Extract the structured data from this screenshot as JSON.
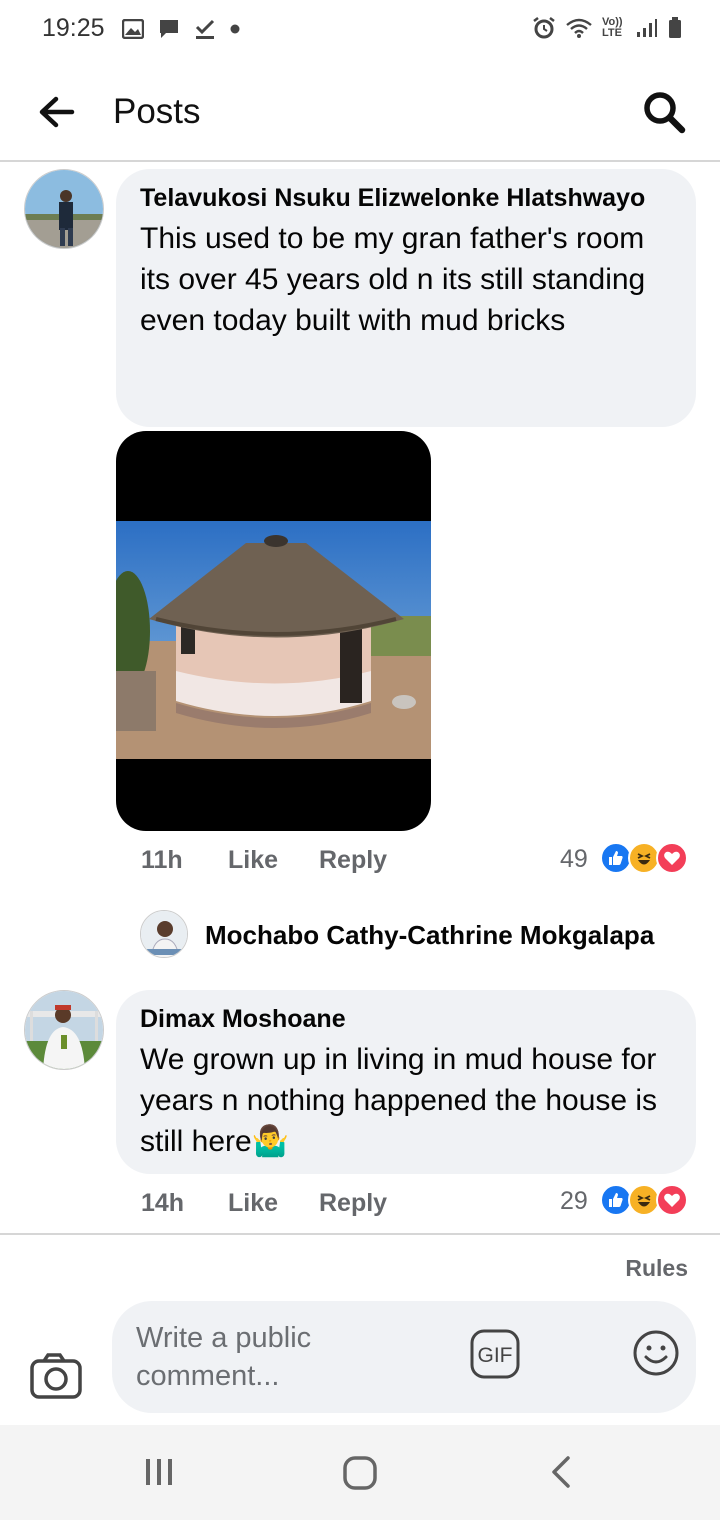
{
  "status_bar": {
    "time": "19:25",
    "left_icons": [
      "image-icon",
      "chat-icon",
      "check-icon",
      "dot-icon"
    ],
    "right_icons": [
      "alarm-icon",
      "wifi-icon",
      "volte-icon",
      "signal-icon",
      "battery-icon"
    ],
    "volte_label": "Vo)) LTE"
  },
  "header": {
    "title": "Posts",
    "back_icon": "back-arrow-icon",
    "search_icon": "search-icon"
  },
  "comments": [
    {
      "author": "Telavukosi Nsuku Elizwelonke Hlatshwayo",
      "text": "This used to be my gran father's room its over 45 years old n its still standing even today built with mud bricks",
      "time": "11h",
      "like_label": "Like",
      "reply_label": "Reply",
      "reaction_count": "49",
      "reactions": [
        "like-icon",
        "haha-icon",
        "love-icon"
      ],
      "reply_preview_author": "Mochabo Cathy-Cathrine Mokgalapa"
    },
    {
      "author": "Dimax Moshoane",
      "text": "We grown up in living in mud house for years n nothing happened the house is still here",
      "emoji": "🤷‍♂️",
      "time": "14h",
      "like_label": "Like",
      "reply_label": "Reply",
      "reaction_count": "29",
      "reactions": [
        "like-icon",
        "haha-icon",
        "love-icon"
      ]
    }
  ],
  "composer": {
    "rules_label": "Rules",
    "placeholder": "Write a public comment...",
    "gif_label": "GIF"
  },
  "nav_bar": {
    "buttons": [
      "recents-icon",
      "home-icon",
      "back-icon"
    ]
  },
  "colors": {
    "like_blue": "#1877f2",
    "love_red": "#f33e58",
    "haha_yellow": "#f7b125",
    "bubble_bg": "#f0f2f5",
    "meta_gray": "#65676b"
  }
}
